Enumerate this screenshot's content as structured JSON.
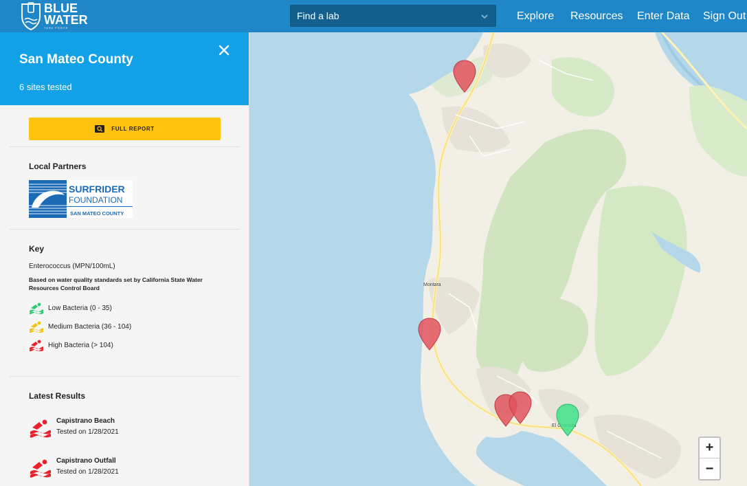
{
  "header": {
    "logo": {
      "line1": "BLUE",
      "line2": "WATER",
      "line3": "TASK FORCE"
    },
    "lab_select": {
      "value": "Find a lab"
    },
    "nav": [
      "Explore",
      "Resources",
      "Enter Data",
      "Sign Out"
    ]
  },
  "sidebar": {
    "title": "San Mateo County",
    "subtitle": "6 sites tested",
    "report_button": "FULL REPORT",
    "partners": {
      "title": "Local Partners",
      "logo": {
        "line1": "SURFRIDER",
        "line2": "FOUNDATION",
        "line3": "SAN MATEO COUNTY"
      }
    },
    "key": {
      "title": "Key",
      "unit": "Enterococcus (MPN/100mL)",
      "note": "Based on water quality standards set by California State Water Resources Control Board",
      "items": [
        {
          "label": "Low Bacteria (0 - 35)",
          "color": "#2ecc71"
        },
        {
          "label": "Medium Bacteria (36 - 104)",
          "color": "#f4c20d"
        },
        {
          "label": "High Bacteria (> 104)",
          "color": "#e8212b"
        }
      ]
    },
    "latest": {
      "title": "Latest Results",
      "items": [
        {
          "name": "Capistrano Beach",
          "date": "Tested on 1/28/2021",
          "color": "#e8212b"
        },
        {
          "name": "Capistrano Outfall",
          "date": "Tested on 1/28/2021",
          "color": "#e8212b"
        }
      ]
    }
  },
  "map": {
    "labels": [
      "Montara",
      "El Granada"
    ],
    "markers": [
      {
        "status": "high",
        "color": "#e2545e"
      },
      {
        "status": "high",
        "color": "#e2545e"
      },
      {
        "status": "high",
        "color": "#e2545e"
      },
      {
        "status": "high",
        "color": "#e2545e"
      },
      {
        "status": "low",
        "color": "#3fe08a"
      }
    ],
    "zoom_in": "+",
    "zoom_out": "−"
  }
}
